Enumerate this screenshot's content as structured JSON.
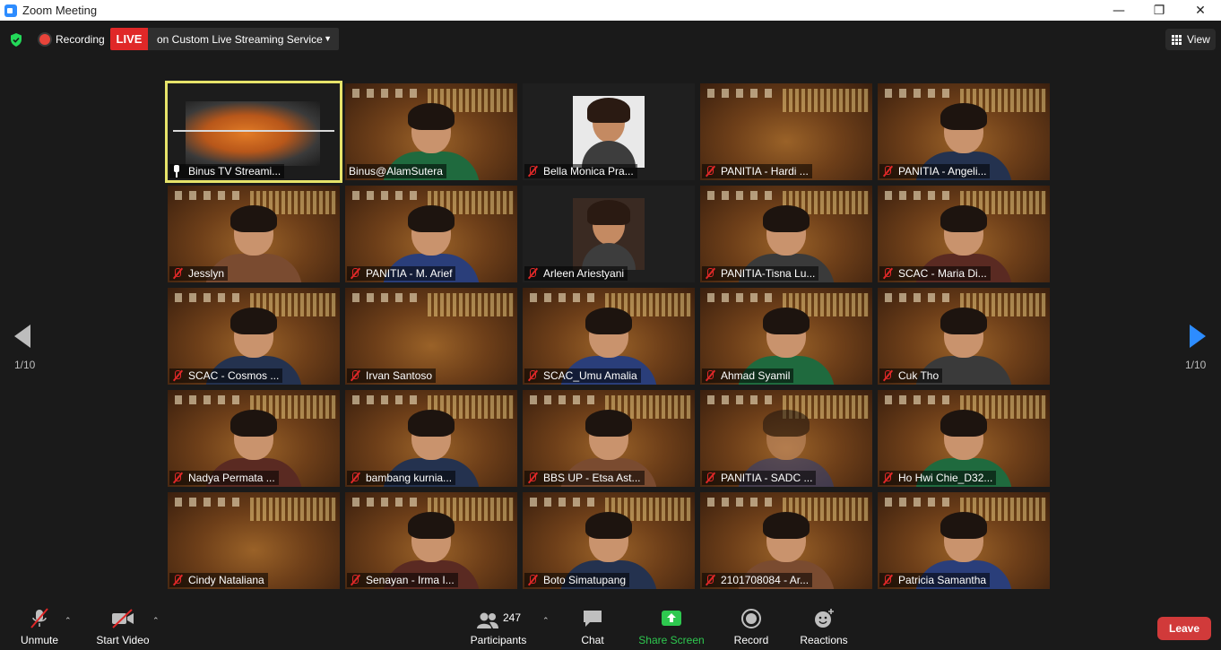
{
  "window": {
    "title": "Zoom Meeting",
    "minimize": "—",
    "restore": "❐",
    "close": "✕"
  },
  "topbar": {
    "recording_label": "Recording",
    "live_label": "LIVE",
    "live_service": "on Custom Live Streaming Service",
    "view_label": "View"
  },
  "gallery": {
    "page_left": "1/10",
    "page_right": "1/10",
    "tiles": [
      {
        "name": "Binus TV Streami...",
        "muted": false,
        "pinned": true,
        "kind": "stream"
      },
      {
        "name": "Binus@AlamSutera",
        "muted": false,
        "kind": "person"
      },
      {
        "name": "Bella Monica Pra...",
        "muted": true,
        "kind": "photo"
      },
      {
        "name": "PANITIA - Hardi ...",
        "muted": true,
        "kind": "empty"
      },
      {
        "name": "PANITIA - Angeli...",
        "muted": true,
        "kind": "person"
      },
      {
        "name": "Jesslyn",
        "muted": true,
        "kind": "person"
      },
      {
        "name": "PANITIA - M. Arief",
        "muted": true,
        "kind": "person"
      },
      {
        "name": "Arleen Ariestyani",
        "muted": true,
        "kind": "photo"
      },
      {
        "name": "PANITIA-Tisna Lu...",
        "muted": true,
        "kind": "person"
      },
      {
        "name": "SCAC - Maria Di...",
        "muted": true,
        "kind": "person"
      },
      {
        "name": "SCAC - Cosmos ...",
        "muted": true,
        "kind": "person"
      },
      {
        "name": "Irvan Santoso",
        "muted": true,
        "kind": "empty"
      },
      {
        "name": "SCAC_Umu Amalia",
        "muted": true,
        "kind": "person"
      },
      {
        "name": "Ahmad Syamil",
        "muted": true,
        "kind": "person"
      },
      {
        "name": "Cuk Tho",
        "muted": true,
        "kind": "person"
      },
      {
        "name": "Nadya Permata ...",
        "muted": true,
        "kind": "person"
      },
      {
        "name": "bambang kurnia...",
        "muted": true,
        "kind": "person"
      },
      {
        "name": "BBS UP - Etsa Ast...",
        "muted": true,
        "kind": "person"
      },
      {
        "name": "PANITIA - SADC ...",
        "muted": true,
        "kind": "room"
      },
      {
        "name": "Ho Hwi Chie_D32...",
        "muted": true,
        "kind": "person"
      },
      {
        "name": "Cindy Nataliana",
        "muted": true,
        "kind": "empty"
      },
      {
        "name": "Senayan - Irma I...",
        "muted": true,
        "kind": "person"
      },
      {
        "name": "Boto Simatupang",
        "muted": true,
        "kind": "person"
      },
      {
        "name": "2101708084 - Ar...",
        "muted": true,
        "kind": "person"
      },
      {
        "name": "Patricia Samantha",
        "muted": true,
        "kind": "person"
      }
    ]
  },
  "toolbar": {
    "unmute": "Unmute",
    "start_video": "Start Video",
    "participants": "Participants",
    "participant_count": "247",
    "chat": "Chat",
    "share_screen": "Share Screen",
    "record": "Record",
    "reactions": "Reactions",
    "leave": "Leave"
  },
  "colors": {
    "live": "#e02828",
    "share": "#2ec84f",
    "leave": "#d13a3a",
    "active_speaker": "#e6e36a",
    "next_page": "#2d8cff"
  }
}
